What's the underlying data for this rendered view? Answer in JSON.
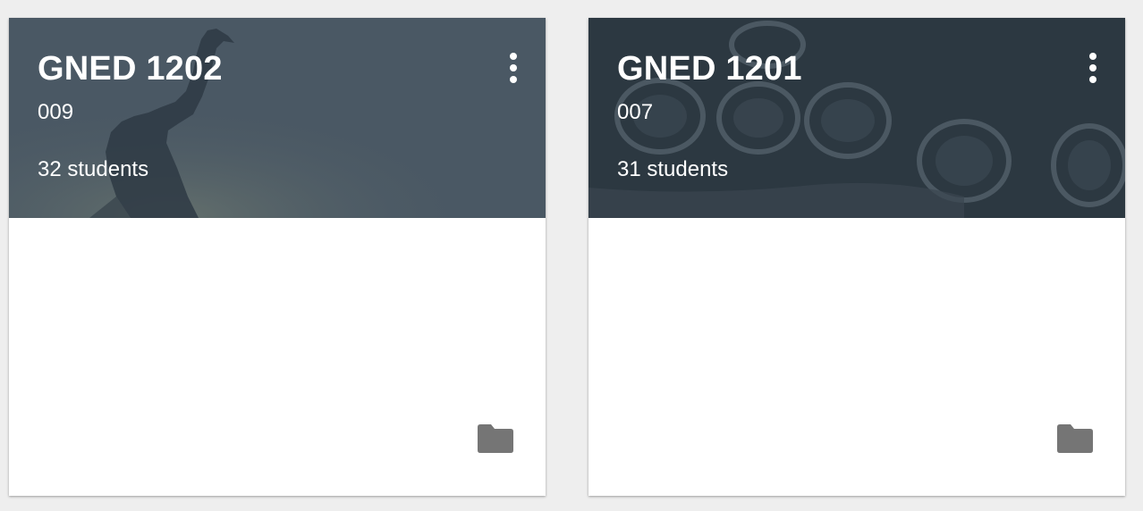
{
  "colors": {
    "page_bg": "#eeeeee",
    "banner_1": "#4a5864",
    "banner_2": "#2c3841",
    "folder": "#757575"
  },
  "cards": [
    {
      "title": "GNED 1202",
      "section": "009",
      "students": "32 students",
      "menu_icon": "more-vert-icon",
      "folder_icon": "folder-icon"
    },
    {
      "title": "GNED 1201",
      "section": "007",
      "students": "31 students",
      "menu_icon": "more-vert-icon",
      "folder_icon": "folder-icon"
    }
  ]
}
